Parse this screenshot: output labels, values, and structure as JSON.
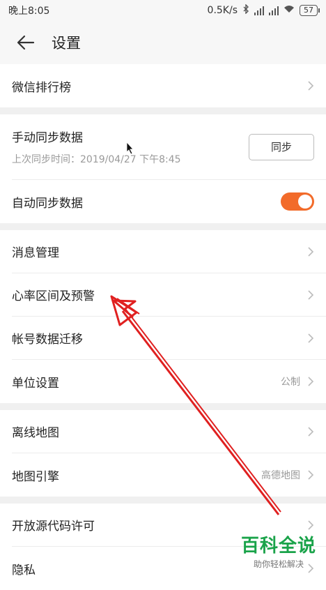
{
  "status_bar": {
    "time": "晚上8:05",
    "net_speed": "0.5K/s",
    "battery": "57"
  },
  "header": {
    "title": "设置"
  },
  "groups": [
    {
      "items": [
        {
          "label": "微信排行榜"
        }
      ]
    },
    {
      "items": [
        {
          "label": "手动同步数据",
          "sub": "上次同步时间：2019/04/27 下午8:45",
          "button": "同步"
        },
        {
          "label": "自动同步数据",
          "toggle": "on"
        }
      ]
    },
    {
      "items": [
        {
          "label": "消息管理"
        },
        {
          "label": "心率区间及预警"
        },
        {
          "label": "帐号数据迁移"
        },
        {
          "label": "单位设置",
          "value": "公制"
        }
      ]
    },
    {
      "items": [
        {
          "label": "离线地图"
        },
        {
          "label": "地图引擎",
          "value": "高德地图"
        }
      ]
    },
    {
      "items": [
        {
          "label": "开放源代码许可"
        },
        {
          "label": "隐私"
        }
      ]
    }
  ],
  "watermark": {
    "main": "百科全说",
    "sub": "助你轻松解决"
  },
  "colors": {
    "accent": "#f26b2a",
    "annotation": "#e02020",
    "watermark": "#1aa34a"
  }
}
